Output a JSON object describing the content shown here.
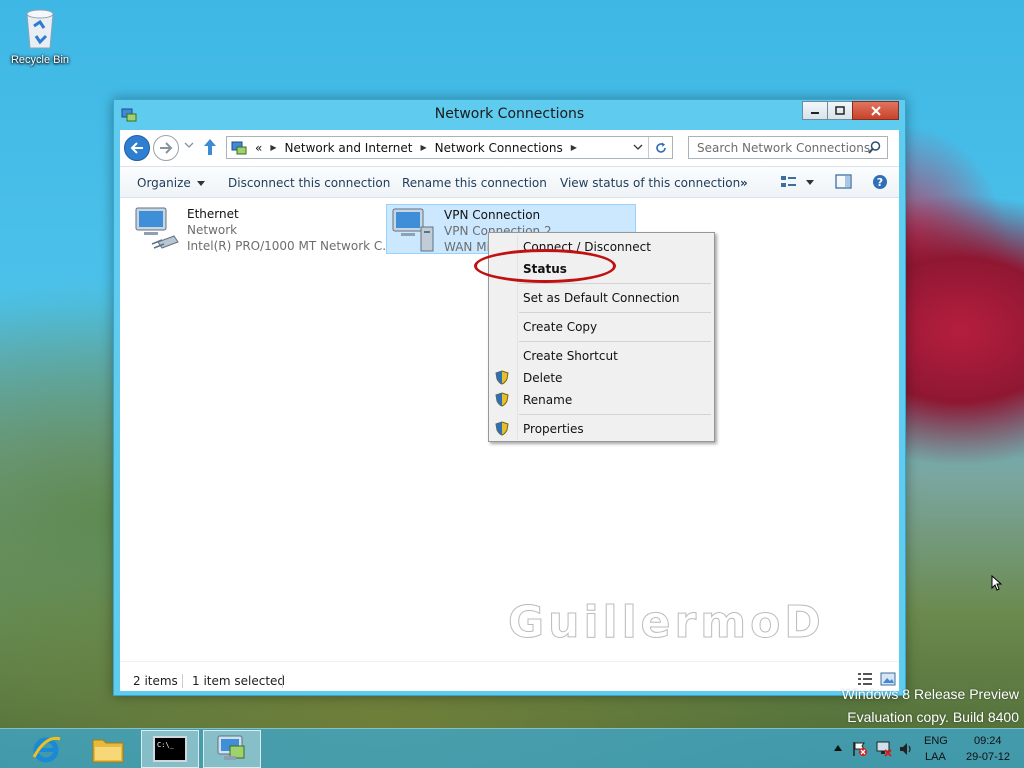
{
  "desktop": {
    "recycle_bin_label": "Recycle Bin",
    "watermark_line1": "Windows 8 Release Preview",
    "watermark_line2": "Evaluation copy. Build 8400",
    "overlay_text": "GuillermoD"
  },
  "window": {
    "title": "Network Connections",
    "address": {
      "prefix": "«",
      "crumbs": [
        "Network and Internet",
        "Network Connections"
      ]
    },
    "search_placeholder": "Search Network Connections",
    "commands": {
      "organize": "Organize",
      "disconnect": "Disconnect this connection",
      "rename": "Rename this connection",
      "view_status": "View status of this connection",
      "more": "»"
    },
    "items": [
      {
        "name": "Ethernet",
        "line2": "Network",
        "line3": "Intel(R) PRO/1000 MT Network C..."
      },
      {
        "name": "VPN Connection",
        "line2": "VPN Connection 2",
        "line3": "WAN Mi"
      }
    ],
    "status": {
      "count": "2 items",
      "selected": "1 item selected"
    }
  },
  "context_menu": {
    "items": [
      {
        "label": "Connect / Disconnect",
        "bold": false,
        "shield": false
      },
      {
        "label": "Status",
        "bold": true,
        "shield": false
      },
      {
        "label": "Set as Default Connection",
        "bold": false,
        "shield": false
      },
      {
        "label": "Create Copy",
        "bold": false,
        "shield": false
      },
      {
        "label": "Create Shortcut",
        "bold": false,
        "shield": false
      },
      {
        "label": "Delete",
        "bold": false,
        "shield": true
      },
      {
        "label": "Rename",
        "bold": false,
        "shield": true
      },
      {
        "label": "Properties",
        "bold": false,
        "shield": true
      }
    ]
  },
  "taskbar": {
    "language": "ENG",
    "language_sub": "LAA",
    "time": "09:24",
    "date": "29-07-12",
    "apps": [
      "internet-explorer",
      "file-explorer",
      "command-prompt",
      "network-connections"
    ]
  },
  "colors": {
    "accent": "#2f7fd0",
    "window_frame": "#5fcbee",
    "selection": "#cce8ff",
    "annotation": "#c01010"
  }
}
